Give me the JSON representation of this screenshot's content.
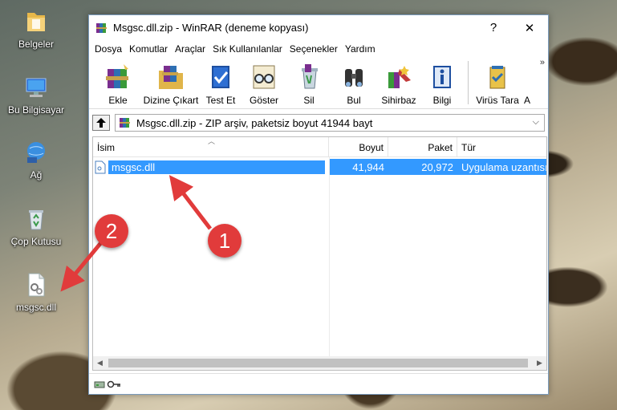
{
  "desktop": {
    "icons": [
      {
        "label": "Belgeler",
        "icon": "folder-icon"
      },
      {
        "label": "Bu Bilgisayar",
        "icon": "computer-icon"
      },
      {
        "label": "Ağ",
        "icon": "network-icon"
      },
      {
        "label": "Çop Kutusu",
        "icon": "recycle-bin-icon"
      },
      {
        "label": "msgsc.dll",
        "icon": "dll-file-icon"
      }
    ]
  },
  "window": {
    "title": "Msgsc.dll.zip - WinRAR (deneme kopyası)",
    "help_glyph": "?",
    "close_glyph": "✕",
    "menu": [
      "Dosya",
      "Komutlar",
      "Araçlar",
      "Sık Kullanılanlar",
      "Seçenekler",
      "Yardım"
    ],
    "toolbar": [
      {
        "label": "Ekle",
        "icon": "add-books-icon"
      },
      {
        "label": "Dizine Çıkart",
        "icon": "extract-folder-icon"
      },
      {
        "label": "Test Et",
        "icon": "test-book-icon"
      },
      {
        "label": "Göster",
        "icon": "view-glasses-icon"
      },
      {
        "label": "Sil",
        "icon": "delete-icon"
      },
      {
        "label": "Bul",
        "icon": "find-binoculars-icon"
      },
      {
        "label": "Sihirbaz",
        "icon": "wizard-icon"
      },
      {
        "label": "Bilgi",
        "icon": "info-icon"
      },
      {
        "label": "Virüs Tara",
        "icon": "virus-scan-icon"
      },
      {
        "label": "A",
        "icon": ""
      }
    ],
    "more_glyph": "»",
    "address": "Msgsc.dll.zip - ZIP arşiv, paketsiz boyut 41944 bayt",
    "columns": {
      "name": "İsim",
      "size": "Boyut",
      "packed": "Paket",
      "type": "Tür"
    },
    "files": [
      {
        "name": "msgsc.dll",
        "size": "41,944",
        "packed": "20,972",
        "type": "Uygulama uzantısı"
      }
    ]
  },
  "annotations": {
    "step1": "1",
    "step2": "2"
  },
  "colors": {
    "selection": "#3399ff",
    "badge": "#e13b3b"
  }
}
